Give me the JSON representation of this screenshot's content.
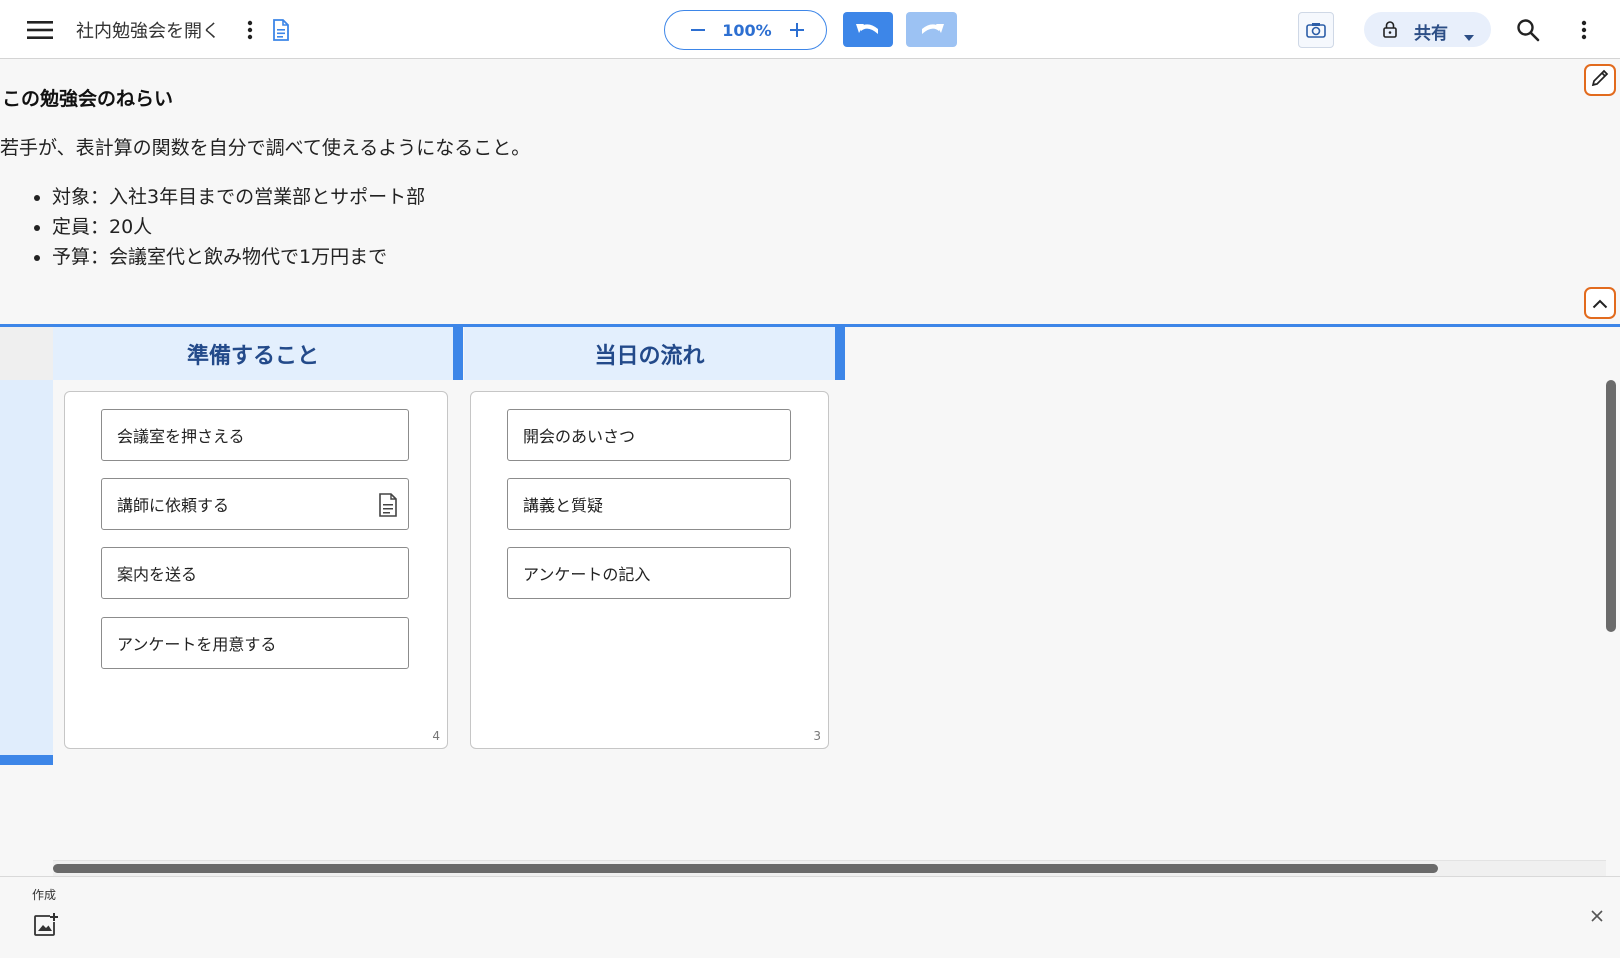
{
  "toolbar": {
    "doc_title": "社内勉強会を開く",
    "zoom": "100%",
    "share_label": "共有",
    "icons": [
      "menu-icon",
      "more-vert-icon",
      "document-icon",
      "zoom-out-icon",
      "zoom-in-icon",
      "undo-icon",
      "redo-icon",
      "camera-icon",
      "lock-icon",
      "caret-down-icon",
      "search-icon"
    ]
  },
  "description": {
    "title": "この勉強会のねらい",
    "lead": "若手が、表計算の関数を自分で調べて使えるようになること。",
    "bullets": [
      "対象：入社3年目までの営業部とサポート部",
      "定員：20人",
      "予算：会議室代と飲み物代で1万円まで"
    ]
  },
  "board": {
    "columns": [
      {
        "title": "準備すること",
        "count": "4",
        "cards": [
          "会議室を押さえる",
          "講師に依頼する",
          "案内を送る",
          "アンケートを用意する"
        ]
      },
      {
        "title": "当日の流れ",
        "count": "3",
        "cards": [
          "開会のあいさつ",
          "講義と質疑",
          "アンケートの記入"
        ]
      }
    ]
  },
  "bottom_panel": {
    "create_label": "作成"
  },
  "colors": {
    "accent": "#3d86e8",
    "header_bg": "#e3effd",
    "header_text": "#234a8a",
    "highlight_border": "#e26b1e"
  }
}
